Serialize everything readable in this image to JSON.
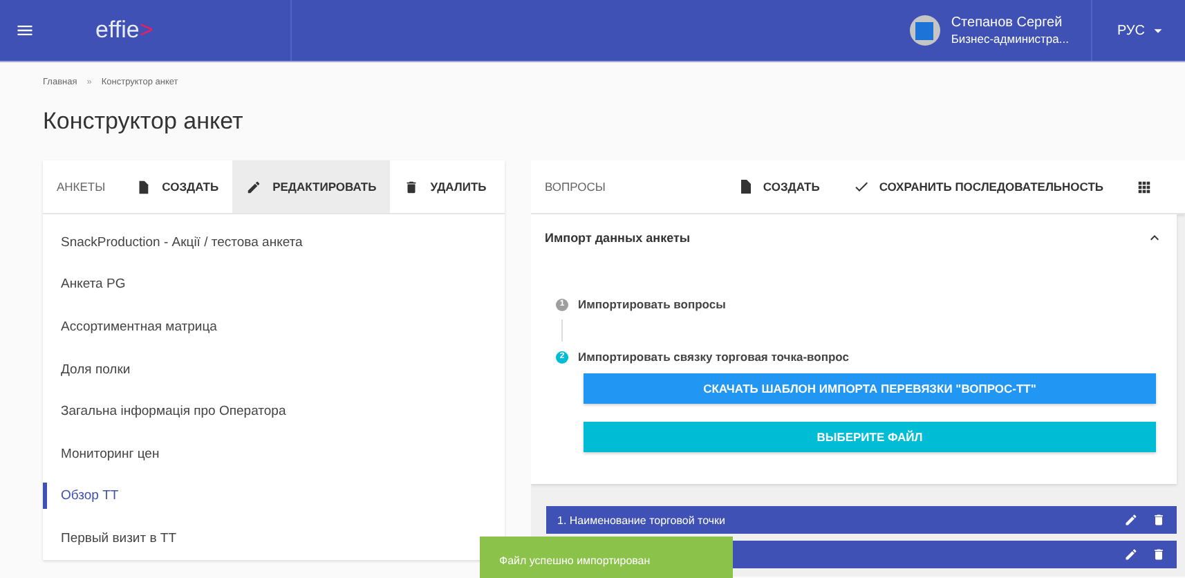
{
  "header": {
    "logo": "effie",
    "logo_mark": ">",
    "user_name": "Степанов Сергей",
    "user_role": "Бизнес-администра...",
    "language": "РУС"
  },
  "breadcrumb_separator": "»",
  "breadcrumbs": [
    {
      "label": "Главная"
    },
    {
      "label": "Конструктор анкет"
    }
  ],
  "page_title": "Конструктор анкет",
  "surveys": {
    "title": "АНКЕТЫ",
    "actions": [
      {
        "kind": "create",
        "label": "СОЗДАТЬ",
        "active": false
      },
      {
        "kind": "edit",
        "label": "РЕДАКТИРОВАТЬ",
        "active": true
      },
      {
        "kind": "delete",
        "label": "УДАЛИТЬ",
        "active": false
      }
    ],
    "items": [
      {
        "label": "SnackProduction - Акції / тестова анкета",
        "selected": false
      },
      {
        "label": "Анкета PG",
        "selected": false
      },
      {
        "label": "Ассортиментная матрица",
        "selected": false
      },
      {
        "label": "Доля полки",
        "selected": false
      },
      {
        "label": "Загальна інформація про Оператора",
        "selected": false
      },
      {
        "label": "Мониторинг цен",
        "selected": false
      },
      {
        "label": "Обзор ТТ",
        "selected": true
      },
      {
        "label": "Первый визит в ТТ",
        "selected": false
      }
    ]
  },
  "questions": {
    "title": "ВОПРОСЫ",
    "actions": [
      {
        "kind": "create",
        "label": "СОЗДАТЬ"
      },
      {
        "kind": "save",
        "label": "СОХРАНИТЬ ПОСЛЕДОВАТЕЛЬНОСТЬ"
      },
      {
        "kind": "grid"
      }
    ],
    "import": {
      "title": "Импорт данных анкеты",
      "expanded": true,
      "steps": [
        {
          "label": "Импортировать вопросы",
          "number": "1",
          "active": false
        },
        {
          "label": "Импортировать связку торговая точка-вопрос",
          "number": "2",
          "active": true
        }
      ],
      "buttons": [
        {
          "kind": "primary",
          "label": "СКАЧАТЬ ШАБЛОН ИМПОРТА ПЕРЕВЯЗКИ \"ВОПРОС-ТТ\""
        },
        {
          "kind": "accent",
          "label": "ВЫБЕРИТЕ ФАЙЛ"
        }
      ]
    },
    "rows": [
      {
        "title": "1. Наименование торговой точки"
      },
      {}
    ]
  },
  "toast": {
    "message": "Файл успешно импортирован"
  }
}
